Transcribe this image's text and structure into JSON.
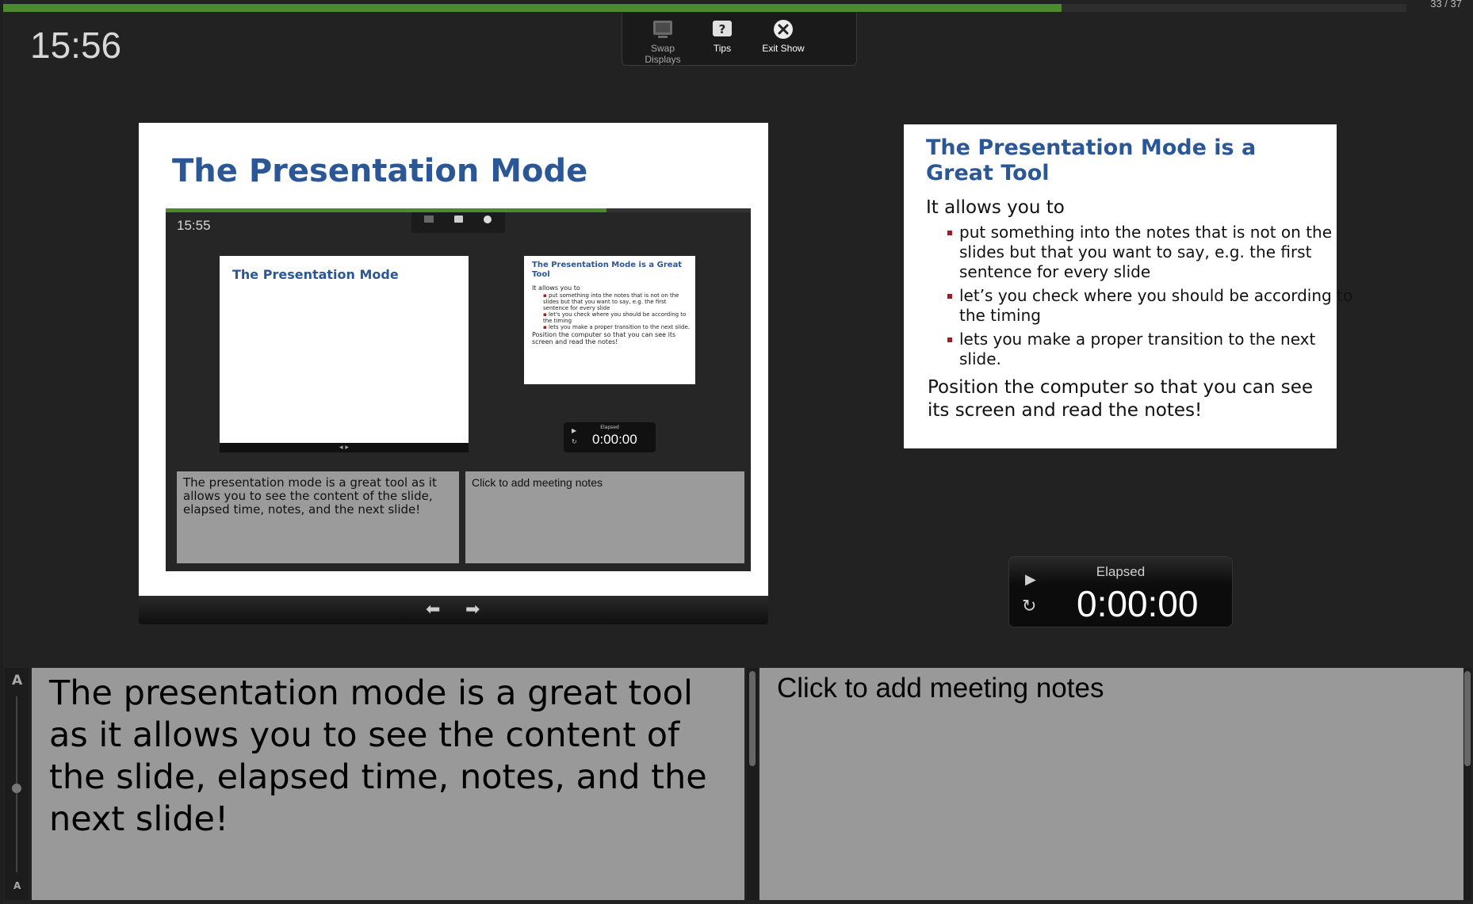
{
  "header": {
    "clock": "15:56",
    "slide_counter": "33 / 37",
    "progress": 0.754
  },
  "toolbar": {
    "swap_label": "Swap Displays",
    "tips_label": "Tips",
    "exit_label": "Exit Show"
  },
  "current_slide": {
    "title": "The Presentation Mode",
    "screenshot": {
      "clock": "15:55",
      "current_title": "The Presentation Mode",
      "next_title": "The Presentation Mode is a Great Tool",
      "next_intro": "It allows you to",
      "next_items": [
        "put something into the notes that is not on the slides but that you want to say, e.g. the first sentence for every slide",
        "let's you check where you should be according to the timing",
        "lets you make a proper transition to the next slide."
      ],
      "next_outro": "Position the computer so that you can see its screen and read the notes!",
      "timer_label": "Elapsed",
      "timer_time": "0:00:00",
      "notes": "The presentation mode is a great tool as it allows you to see the content of the slide, elapsed time, notes, and the next slide!",
      "meeting_notes": "Click to add meeting notes"
    }
  },
  "next_slide": {
    "title": "The Presentation Mode is a Great Tool",
    "intro": "It allows you to",
    "items": [
      "put something into the notes that is not on the slides but that you want to say, e.g. the first sentence for every slide",
      "let’s you check where you should be according to the timing",
      "lets you make a proper transition to the next slide."
    ],
    "outro": "Position the computer so that you can see its screen and read the notes!"
  },
  "timer": {
    "label": "Elapsed",
    "time": "0:00:00"
  },
  "notes": {
    "text": "The presentation mode is a great tool as it allows you to see the content of the slide, elapsed time, notes, and the next slide!",
    "size_large": "A",
    "size_small": "A"
  },
  "meeting_notes": {
    "placeholder": "Click to add meeting notes"
  },
  "colors": {
    "progress": "#4d8a2c",
    "title_blue": "#2b5797",
    "bullet_red": "#a01d1d",
    "notes_bg": "#999999"
  }
}
